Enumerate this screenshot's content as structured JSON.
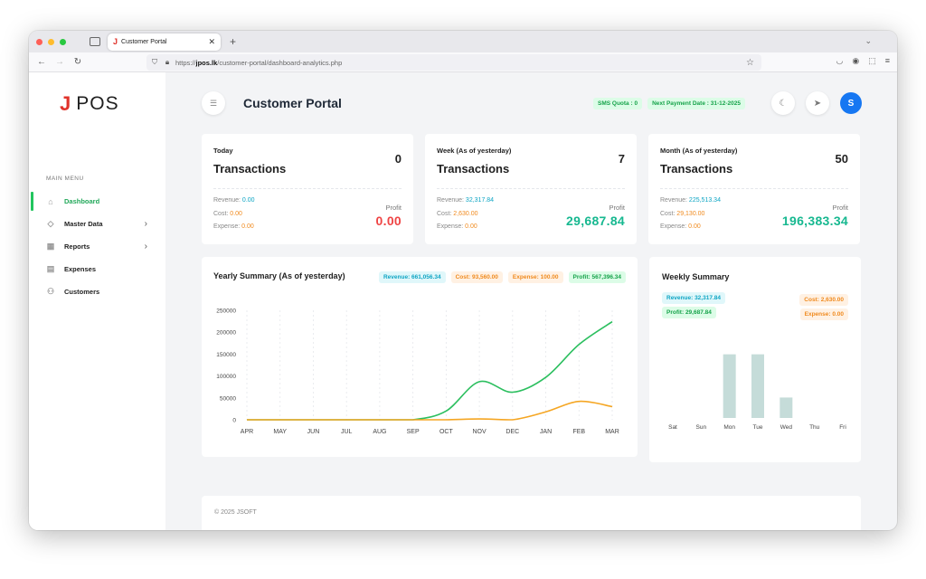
{
  "browser": {
    "tab_title": "Customer Portal",
    "url_prefix": "https://",
    "url_host": "jpos.lk",
    "url_path": "/customer-portal/dashboard-analytics.php"
  },
  "sidebar": {
    "logo_j": "J",
    "logo_text": "POS",
    "menu_heading": "MAIN MENU",
    "items": [
      {
        "label": "Dashboard",
        "icon": "home-icon",
        "active": true
      },
      {
        "label": "Master Data",
        "icon": "database-icon",
        "has_submenu": true
      },
      {
        "label": "Reports",
        "icon": "grid-icon",
        "has_submenu": true
      },
      {
        "label": "Expenses",
        "icon": "receipt-icon"
      },
      {
        "label": "Customers",
        "icon": "user-icon"
      }
    ]
  },
  "header": {
    "title": "Customer Portal",
    "sms_quota": "SMS Quota : 0",
    "next_payment": "Next Payment Date : 31-12-2025",
    "avatar_initial": "S"
  },
  "stats": [
    {
      "period": "Today",
      "title": "Transactions",
      "count": "0",
      "revenue_label": "Revenue:",
      "revenue": "0.00",
      "cost_label": "Cost:",
      "cost": "0.00",
      "expense_label": "Expense:",
      "expense": "0.00",
      "profit_label": "Profit",
      "profit": "0.00",
      "profit_color": "#ef4444"
    },
    {
      "period": "Week (As of yesterday)",
      "title": "Transactions",
      "count": "7",
      "revenue_label": "Revenue:",
      "revenue": "32,317.84",
      "cost_label": "Cost:",
      "cost": "2,630.00",
      "expense_label": "Expense:",
      "expense": "0.00",
      "profit_label": "Profit",
      "profit": "29,687.84",
      "profit_color": "#17b890"
    },
    {
      "period": "Month (As of yesterday)",
      "title": "Transactions",
      "count": "50",
      "revenue_label": "Revenue:",
      "revenue": "225,513.34",
      "cost_label": "Cost:",
      "cost": "29,130.00",
      "expense_label": "Expense:",
      "expense": "0.00",
      "profit_label": "Profit",
      "profit": "196,383.34",
      "profit_color": "#17b890"
    }
  ],
  "yearly": {
    "title": "Yearly Summary (As of yesterday)",
    "pills": {
      "revenue": "Revenue: 661,056.34",
      "cost": "Cost: 93,560.00",
      "expense": "Expense: 100.00",
      "profit": "Profit: 567,396.34"
    }
  },
  "weekly": {
    "title": "Weekly Summary",
    "pills": {
      "revenue": "Revenue: 32,317.84",
      "profit": "Profit: 29,687.84",
      "cost": "Cost: 2,630.00",
      "expense": "Expense: 0.00"
    }
  },
  "footer": {
    "text": "© 2025 JSOFT"
  },
  "chart_data": [
    {
      "type": "line",
      "title": "Yearly Summary (As of yesterday)",
      "categories": [
        "APR",
        "MAY",
        "JUN",
        "JUL",
        "AUG",
        "SEP",
        "OCT",
        "NOV",
        "DEC",
        "JAN",
        "FEB",
        "MAR"
      ],
      "yticks": [
        0,
        50000,
        100000,
        150000,
        200000,
        250000
      ],
      "ylim": [
        0,
        250000
      ],
      "series": [
        {
          "color": "#2cbf5f",
          "values": [
            0,
            0,
            0,
            0,
            0,
            0,
            20000,
            87000,
            63000,
            97000,
            172000,
            224000
          ]
        },
        {
          "color": "#f5a623",
          "values": [
            0,
            0,
            0,
            0,
            0,
            0,
            0,
            2000,
            0,
            18000,
            42000,
            30000
          ]
        }
      ],
      "grid": true
    },
    {
      "type": "bar",
      "title": "Weekly Summary",
      "categories": [
        "Sat",
        "Sun",
        "Mon",
        "Tue",
        "Wed",
        "Thu",
        "Fri"
      ],
      "values": [
        0,
        0,
        14000,
        14000,
        4500,
        0,
        0
      ],
      "ylim": [
        0,
        19500
      ],
      "color": "#c5dcd9"
    }
  ]
}
